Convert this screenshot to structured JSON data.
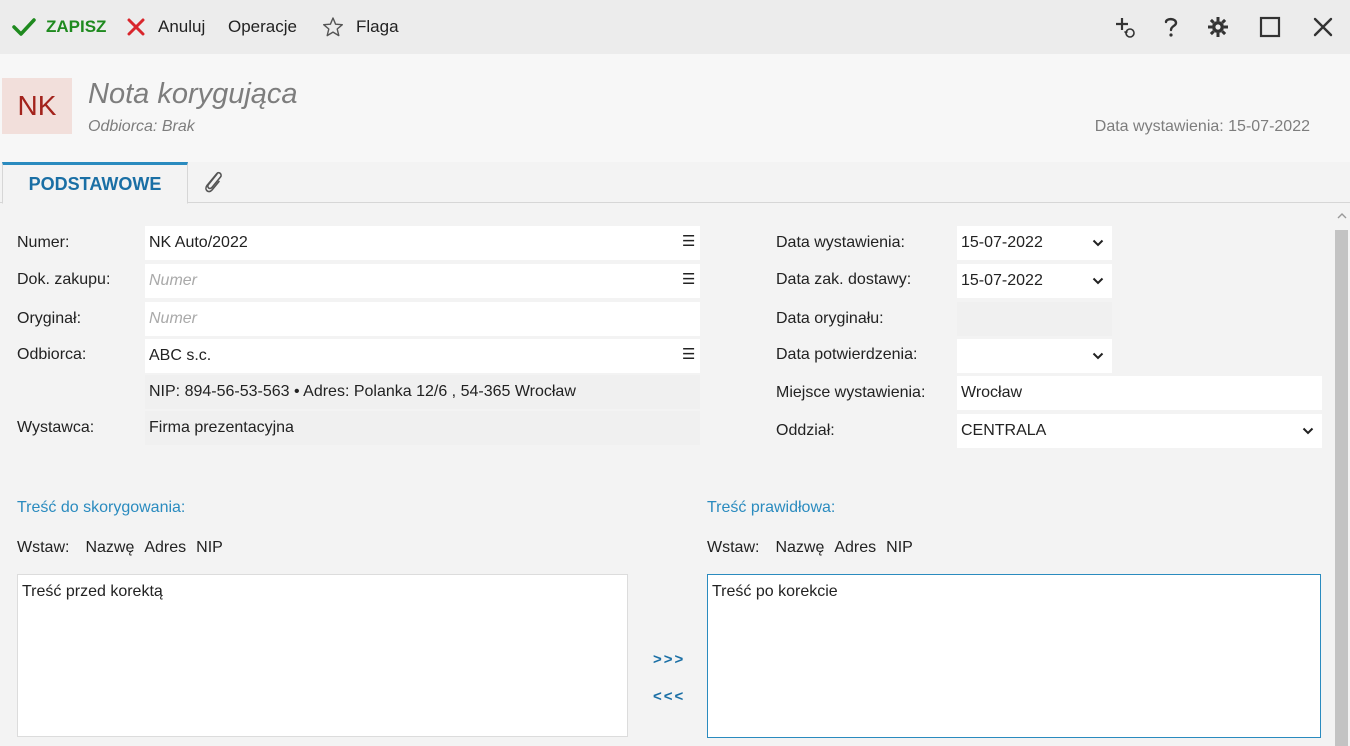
{
  "toolbar": {
    "save": "ZAPISZ",
    "cancel": "Anuluj",
    "operations": "Operacje",
    "flag": "Flaga",
    "right_icons": [
      "add-linked-icon",
      "help-icon",
      "gear-icon",
      "maximize-icon",
      "close-icon"
    ]
  },
  "header": {
    "badge": "NK",
    "title": "Nota korygująca",
    "recipient": "Odbiorca:  Brak",
    "issue_date": "Data wystawienia: 15-07-2022"
  },
  "tabs": {
    "active": "PODSTAWOWE",
    "attachment_icon": "paperclip-icon"
  },
  "form_left": {
    "number_label": "Numer:",
    "number_value": "NK Auto/2022",
    "purchase_doc_label": "Dok. zakupu:",
    "purchase_doc_placeholder": "Numer",
    "original_label": "Oryginał:",
    "original_placeholder": "Numer",
    "recipient_label": "Odbiorca:",
    "recipient_value": "ABC s.c.",
    "recipient_info": "NIP:  894-56-53-563  •  Adres:  Polanka  12/6 , 54-365 Wrocław",
    "issuer_label": "Wystawca:",
    "issuer_value": "Firma prezentacyjna"
  },
  "form_right": {
    "issue_date_label": "Data wystawienia:",
    "issue_date_value": "15-07-2022",
    "delivery_date_label": "Data zak. dostawy:",
    "delivery_date_value": "15-07-2022",
    "original_date_label": "Data oryginału:",
    "confirm_date_label": "Data potwierdzenia:",
    "confirm_date_value": "",
    "place_label": "Miejsce wystawienia:",
    "place_value": "Wrocław",
    "branch_label": "Oddział:",
    "branch_value": "CENTRALA"
  },
  "correction": {
    "left_title": "Treść do skorygowania:",
    "right_title": "Treść prawidłowa:",
    "insert_label": "Wstaw:",
    "insert_name": "Nazwę",
    "insert_address": "Adres",
    "insert_nip": "NIP",
    "left_text": "Treść przed korektą",
    "right_text": "Treść po korekcie",
    "copy_right": ">>>",
    "copy_left": "<<<"
  }
}
